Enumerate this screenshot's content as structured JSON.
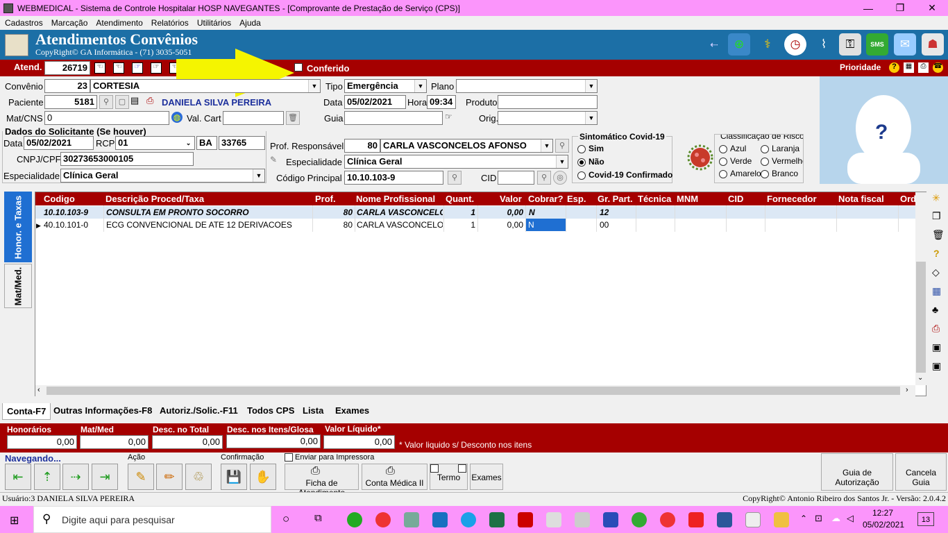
{
  "window": {
    "title": "WEBMEDICAL - Sistema de Controle Hospitalar HOSP NAVEGANTES - [Comprovante de Prestação de Serviço  (CPS)]",
    "minimize": "—",
    "restore": "❐",
    "close": "✕"
  },
  "menu": [
    "Cadastros",
    "Marcação",
    "Atendimento",
    "Relatórios",
    "Utilitários",
    "Ajuda"
  ],
  "header": {
    "title": "Atendimentos Convênios",
    "copyright": "CopyRight© GA Informática - (71) 3035-5051",
    "sms_label": "SMS"
  },
  "atend": {
    "label": "Atend.",
    "value": "26719",
    "conferido_label": "Conferido",
    "prioridade_label": "Prioridade"
  },
  "form": {
    "convenio_label": "Convênio",
    "convenio_code": "23",
    "convenio_name": "CORTESIA",
    "tipo_label": "Tipo",
    "tipo_value": "Emergência",
    "plano_label": "Plano",
    "plano_value": "",
    "paciente_label": "Paciente",
    "paciente_code": "5181",
    "paciente_name": "DANIELA SILVA PEREIRA",
    "data_label": "Data",
    "data_value": "05/02/2021",
    "hora_label": "Hora",
    "hora_value": "09:34",
    "produto_label": "Produto",
    "produto_value": "",
    "matcns_label": "Mat/CNS",
    "matcns_value": "0",
    "valcart_label": "Val. Cart",
    "valcart_value": "",
    "guia_label": "Guia",
    "guia_value": "",
    "orig_label": "Orig.",
    "orig_value": ""
  },
  "solicitante": {
    "section_label": "Dados do Solicitante (Se houver)",
    "data_label": "Data",
    "data_value": "05/02/2021",
    "rcp_label": "RCP",
    "rcp_value": "01",
    "uf_value": "BA",
    "num_value": "33765",
    "cnpj_label": "CNPJ/CPF",
    "cnpj_value": "30273653000105",
    "esp_label": "Especialidade",
    "esp_value": "Clínica Geral"
  },
  "responsavel": {
    "prof_label": "Prof. Responsável",
    "prof_code": "80",
    "prof_name": "CARLA VASCONCELOS AFONSO",
    "esp_label": "Especialidade",
    "esp_value": "Clínica Geral",
    "codigo_label": "Código Principal",
    "codigo_value": "10.10.103-9",
    "cid_label": "CID",
    "cid_value": ""
  },
  "covid": {
    "title": "Sintomático Covid-19",
    "options": [
      "Sim",
      "Não",
      "Covid-19 Confirmado"
    ],
    "selected": "Não"
  },
  "risco": {
    "title": "Classificação de Risco",
    "options": [
      "Azul",
      "Laranja",
      "Verde",
      "Vermelho",
      "Amarelo",
      "Branco"
    ]
  },
  "side_tabs": [
    "Honor. e Taxas",
    "Mat/Med."
  ],
  "grid": {
    "columns": [
      "Codigo",
      "Descrição Proced/Taxa",
      "Prof.",
      "Nome Profissional",
      "Quant.",
      "Valor",
      "Cobrar?",
      "Esp.",
      "Gr. Part.",
      "Técnica",
      "MNM",
      "CID",
      "Fornecedor",
      "Nota fiscal",
      "Ordem"
    ],
    "rows": [
      {
        "codigo": "10.10.103-9",
        "descricao": "CONSULTA EM PRONTO SOCORRO",
        "prof": "80",
        "nome": "CARLA VASCONCELOS AFONSO",
        "quant": "1",
        "valor": "0,00",
        "cobrar": "N",
        "grpart": "12"
      },
      {
        "codigo": "40.10.101-0",
        "descricao": "ECG CONVENCIONAL DE ATE 12 DERIVACOES",
        "prof": "80",
        "nome": "CARLA VASCONCELOS AFONSO",
        "quant": "1",
        "valor": "0,00",
        "cobrar": "N",
        "grpart": "00"
      }
    ]
  },
  "bottom_tabs": [
    "Conta-F7",
    "Outras Informações-F8",
    "Autoriz./Solic.-F11",
    "Todos CPS",
    "Lista",
    "Exames"
  ],
  "totals": {
    "honorarios_label": "Honorários",
    "honorarios_value": "0,00",
    "matmed_label": "Mat/Med",
    "matmed_value": "0,00",
    "desc_total_label": "Desc. no Total",
    "desc_total_value": "0,00",
    "desc_itens_label": "Desc. nos Itens/Glosa",
    "desc_itens_value": "0,00",
    "liquido_label": "Valor Líquido*",
    "liquido_value": "0,00",
    "note": "* Valor liquido s/ Desconto nos itens"
  },
  "actions": {
    "navegando": "Navegando...",
    "acao": "Ação",
    "confirmacao": "Confirmação",
    "enviar_impressora": "Enviar para Impressora",
    "ficha": "Ficha de Atendimento",
    "conta_medica": "Conta Médica II",
    "termo": "Termo",
    "exames": "Exames",
    "guia_autorizacao": "Guia de Autorização",
    "cancela_guia": "Cancela Guia"
  },
  "status": {
    "user": "Usuário:3 DANIELA SILVA PEREIRA",
    "copyright": "CopyRight© Antonio Ribeiro dos Santos Jr. - Versão: 2.0.4.2"
  },
  "taskbar": {
    "search_placeholder": "Digite aqui para pesquisar",
    "time": "12:27",
    "date": "05/02/2021",
    "notifications": "13"
  },
  "colors": {
    "titlebar": "#fb95fb",
    "header_blue": "#1c6fa6",
    "dark_red": "#a50000",
    "selected_blue": "#1f6fd2",
    "arrow_yellow": "#f5f500"
  }
}
